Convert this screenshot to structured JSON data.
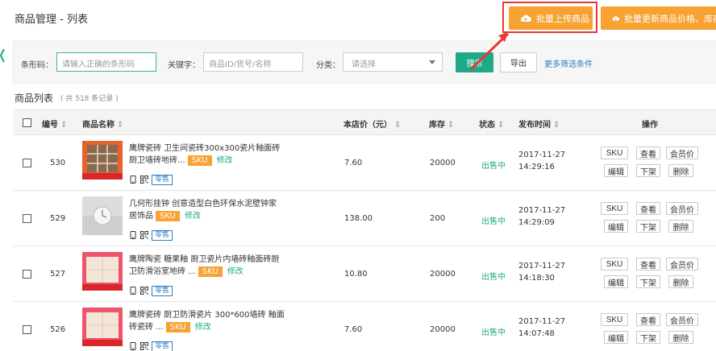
{
  "header": {
    "title": "商品管理 - 列表",
    "upload_button": "批量上传商品",
    "update_button": "批量更新商品价格、库存"
  },
  "filters": {
    "barcode_label": "条形码：",
    "barcode_placeholder": "请输入正确的条形码",
    "keyword_label": "关键字：",
    "keyword_placeholder": "商品ID/货号/名称",
    "category_label": "分类：",
    "category_value": "请选择",
    "search_button": "搜索",
    "export_button": "导出",
    "more_link": "更多筛选条件"
  },
  "list": {
    "title": "商品列表",
    "count": "( 共 518 条记录 )",
    "columns": {
      "id": "编号",
      "name": "商品名称",
      "price": "本店价（元）",
      "stock": "库存",
      "status": "状态",
      "time": "发布时间",
      "ops": "操作"
    },
    "sort_glyph": "⇕",
    "rows": [
      {
        "id": "530",
        "name_line1": "鹰牌瓷砖 卫生间瓷砖300x300瓷片釉面砖",
        "name_line2": "厨卫墙砖地砖...",
        "price": "7.60",
        "stock": "20000",
        "status": "出售中",
        "date": "2017-11-27",
        "time": "14:29:16",
        "thumb": "tile-orange"
      },
      {
        "id": "529",
        "name_line1": "几何形挂钟 创意造型白色环保水泥壁钟家",
        "name_line2": "居饰品",
        "price": "138.00",
        "stock": "200",
        "status": "出售中",
        "date": "2017-11-27",
        "time": "14:29:09",
        "thumb": "clock-gray"
      },
      {
        "id": "527",
        "name_line1": "鹰牌陶瓷 糖果釉 厨卫瓷片内墙砖釉面砖厨",
        "name_line2": "卫防滑浴室地砖 ...",
        "price": "10.80",
        "stock": "20000",
        "status": "出售中",
        "date": "2017-11-27",
        "time": "14:18:30",
        "thumb": "tile-pink"
      },
      {
        "id": "526",
        "name_line1": "鹰牌瓷砖 厨卫防滑瓷片 300*600墙砖 釉面",
        "name_line2": "砖瓷砖 ...",
        "price": "7.60",
        "stock": "20000",
        "status": "出售中",
        "date": "2017-11-27",
        "time": "14:07:48",
        "thumb": "tile-pink"
      }
    ],
    "row_labels": {
      "sku": "SKU",
      "edit": "修改",
      "retail": "零售",
      "btn_sku": "SKU",
      "btn_view": "查看",
      "btn_member": "会员价",
      "btn_edit": "编辑",
      "btn_off": "下架",
      "btn_delete": "删除"
    }
  },
  "colors": {
    "accent_green": "#20a987",
    "orange": "#f7a233",
    "link_blue": "#2d7cc2",
    "highlight_red": "#e53935"
  }
}
